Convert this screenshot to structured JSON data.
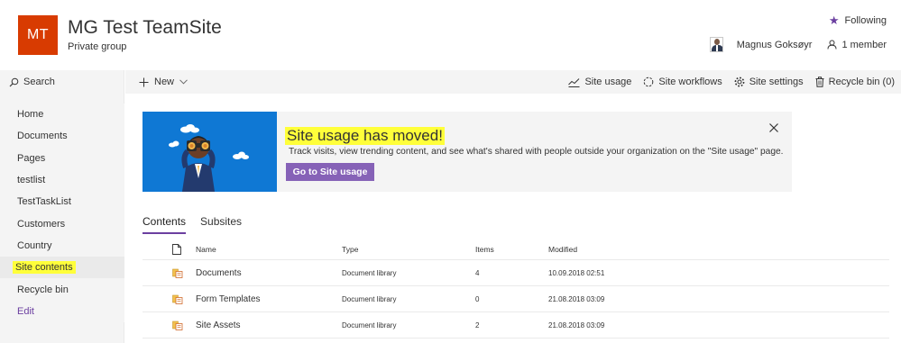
{
  "site": {
    "logo_initials": "MT",
    "title": "MG Test TeamSite",
    "subtitle": "Private group",
    "logo_color": "#d83b01"
  },
  "header": {
    "following_label": "Following",
    "user_name": "Magnus Goksøyr",
    "members_label": "1 member"
  },
  "leftnav": {
    "search_label": "Search",
    "items": [
      {
        "label": "Home"
      },
      {
        "label": "Documents"
      },
      {
        "label": "Pages"
      },
      {
        "label": "testlist"
      },
      {
        "label": "TestTaskList"
      },
      {
        "label": "Customers"
      },
      {
        "label": "Country"
      },
      {
        "label": "Site contents"
      },
      {
        "label": "Recycle bin"
      }
    ],
    "edit_label": "Edit"
  },
  "command_bar": {
    "new_label": "New",
    "site_usage_label": "Site usage",
    "site_workflows_label": "Site workflows",
    "site_settings_label": "Site settings",
    "recycle_bin_label": "Recycle bin (0)"
  },
  "banner": {
    "title": "Site usage has moved!",
    "text": "Track visits, view trending content, and see what's shared with people outside your organization on the \"Site usage\" page.",
    "button_label": "Go to Site usage"
  },
  "tabs": [
    {
      "label": "Contents",
      "active": true
    },
    {
      "label": "Subsites",
      "active": false
    }
  ],
  "table": {
    "headers": {
      "name": "Name",
      "type": "Type",
      "items": "Items",
      "modified": "Modified"
    },
    "rows": [
      {
        "name": "Documents",
        "type": "Document library",
        "items": "4",
        "modified": "10.09.2018 02:51"
      },
      {
        "name": "Form Templates",
        "type": "Document library",
        "items": "0",
        "modified": "21.08.2018 03:09"
      },
      {
        "name": "Site Assets",
        "type": "Document library",
        "items": "2",
        "modified": "21.08.2018 03:09"
      }
    ]
  },
  "colors": {
    "accent": "#6b3fa0",
    "button": "#8662b7",
    "highlight": "#ffff3a",
    "banner_art": "#0f78d4"
  }
}
